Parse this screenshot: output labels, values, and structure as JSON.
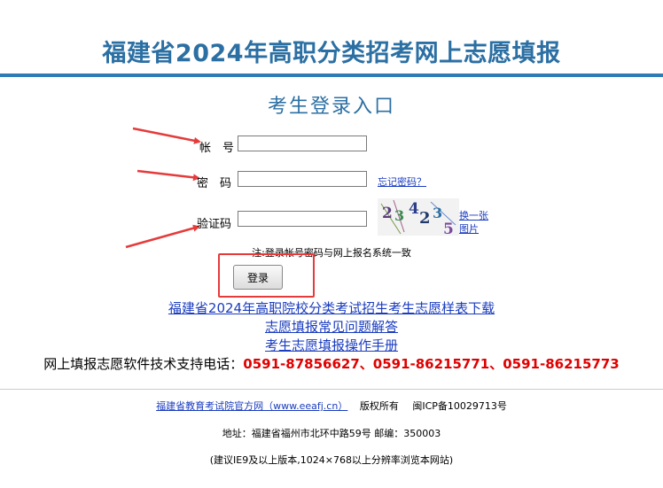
{
  "header": {
    "title": "福建省2024年高职分类招考网上志愿填报"
  },
  "login": {
    "subtitle": "考生登录入口",
    "account_label": "帐　号",
    "password_label": "密　码",
    "captcha_label": "验证码",
    "forgot_password": "忘记密码？",
    "captcha_text": [
      "2",
      "3",
      "4",
      "2",
      "3",
      "5"
    ],
    "refresh_line1": "换一张",
    "refresh_line2": "图片",
    "note": "注:登录帐号密码与网上报名系统一致",
    "login_button": "登录"
  },
  "links": {
    "download": "福建省2024年高职院校分类考试招生考生志愿样表下载",
    "faq": "志愿填报常见问题解答",
    "manual": "考生志愿填报操作手册"
  },
  "support": {
    "label": "网上填报志愿软件技术支持电话：",
    "phones": "0591-87856627、0591-86215771、0591-86215773"
  },
  "footer": {
    "official_site": "福建省教育考试院官方网（www.eeafj.cn）",
    "copyright": "版权所有",
    "icp": "闽ICP备10029713号",
    "address": "地址：福建省福州市北环中路59号 邮编：350003",
    "browser_note": "(建议IE9及以上版本,1024×768以上分辨率浏览本网站)"
  },
  "colors": {
    "title": "#2b6fa3",
    "rule": "#2f7bb5",
    "phones": "#e00000",
    "link": "#1a3cbf",
    "annotation": "#e53b3b"
  }
}
